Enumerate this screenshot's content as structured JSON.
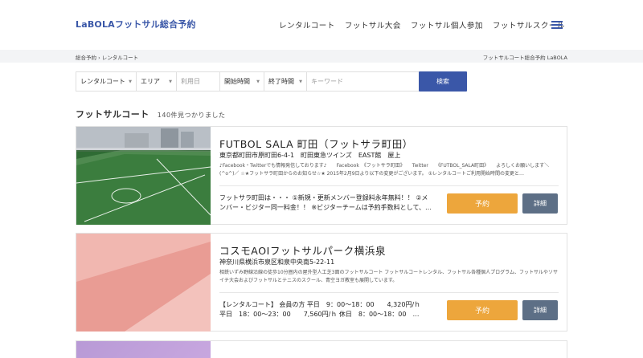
{
  "header": {
    "logo": "LaBOLAフットサル総合予約",
    "nav": [
      "レンタルコート",
      "フットサル大会",
      "フットサル個人参加",
      "フットサルスクール"
    ]
  },
  "breadcrumb": {
    "path": "総合予約 › レンタルコート",
    "right_title": "フットサルコート総合予約 LaBOLA"
  },
  "search": {
    "selects": [
      "レンタルコート",
      "エリア"
    ],
    "date_placeholder": "利用日",
    "time_selects": [
      "開始時間",
      "終了時間"
    ],
    "keyword_placeholder": "キーワード",
    "button": "検索"
  },
  "results": {
    "heading": "フットサルコート",
    "count": "140件見つかりました"
  },
  "courts": [
    {
      "name": "FUTBOL SALA 町田（フットサラ町田）",
      "address": "東京都町田市原町田6-4-1　町田東急ツインズ　EAST館　屋上",
      "description": "♪Facebook・Twitterでも情報発信しております♪　　Facebook　《フットサラ町田》　　Twitter　　《FUTBOL_SALA町田》　　よろしくお願いします＼(^o^)／ ☆★フットサラ町田からのお知らせ☆★ 2015年2月9日より以下の変更がございます。 ①レンタルコートご利用開始時間の変更と…",
      "price": "フットサラ町田は・・・ ①新規・更新メンバー登録料永年無料！！ ②メンバー・ビジター同一料金！！ ※ビジターチームは予約手数料として、…",
      "book_label": "予約",
      "detail_label": "詳細"
    },
    {
      "name": "コスモAOIフットサルパーク横浜泉",
      "address": "神奈川県横浜市泉区和泉中央南5-22-11",
      "description": "相鉄いずみ野線沿線の徒歩10分圏内の屋外型人工芝3面のフットサルコート フットサルコートレンタル、フットサル各種個人プログラム、フットサルやソサイチ大会およびフットサルとテニスのスクール、青空ヨガ教室も展開しています。",
      "price": "【レンタルコート】 会員の方 平日　9：00〜18：00　　4,320円/ｈ　平日　18：00〜23：00　　7,560円/ｈ 休日　8：00〜18：00　…",
      "book_label": "予約",
      "detail_label": "詳細"
    }
  ],
  "colors": {
    "brand": "#3a57a8",
    "book": "#eda63c",
    "detail": "#5d6f86"
  }
}
